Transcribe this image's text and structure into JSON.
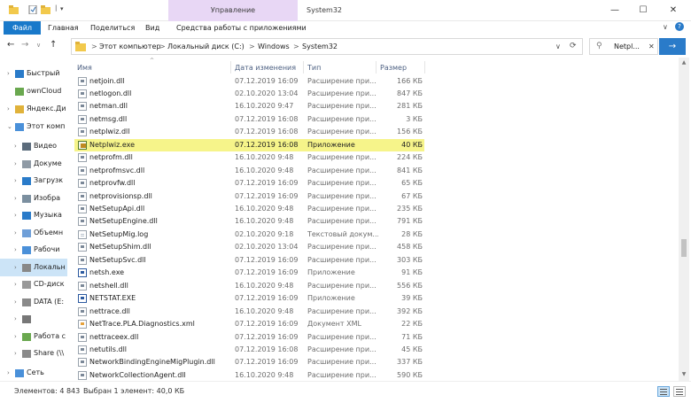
{
  "titlebar": {
    "context_group": "Управление",
    "title": "System32",
    "minimize": "—",
    "maximize": "☐",
    "close": "✕"
  },
  "ribbon": {
    "tabs": [
      "Файл",
      "Главная",
      "Поделиться",
      "Вид",
      "Средства работы с приложениями"
    ]
  },
  "address": {
    "crumbs": [
      "Этот компьютер",
      "Локальный диск (C:)",
      "Windows",
      "System32"
    ],
    "separator": ">",
    "dropdown": "∨",
    "refresh": "⟳"
  },
  "search": {
    "value": "Netpl...",
    "clear": "✕",
    "go": "→"
  },
  "nav": {
    "back": "←",
    "forward": "→",
    "down": "∨",
    "up": "↑",
    "items": [
      {
        "label": "Быстрый",
        "chevron": "›"
      },
      {
        "label": "ownCloud",
        "chevron": ""
      },
      {
        "label": "Яндекс.Ди",
        "chevron": "›"
      },
      {
        "label": "Этот комп",
        "chevron": "⌄"
      },
      {
        "label": "Видео",
        "chevron": "›"
      },
      {
        "label": "Докуме",
        "chevron": "›"
      },
      {
        "label": "Загрузк",
        "chevron": "›"
      },
      {
        "label": "Изобра",
        "chevron": "›"
      },
      {
        "label": "Музыка",
        "chevron": "›"
      },
      {
        "label": "Объемн",
        "chevron": "›"
      },
      {
        "label": "Рабочи",
        "chevron": "›"
      },
      {
        "label": "Локальн",
        "chevron": "›"
      },
      {
        "label": "CD-диск",
        "chevron": "›"
      },
      {
        "label": "DATA (E:",
        "chevron": "›"
      },
      {
        "label": "",
        "chevron": "›"
      },
      {
        "label": "Работа с",
        "chevron": "›"
      },
      {
        "label": "Share (\\\\",
        "chevron": "›"
      },
      {
        "label": "Сеть",
        "chevron": "›"
      }
    ]
  },
  "columns": {
    "name": "Имя",
    "date": "Дата изменения",
    "type": "Тип",
    "size": "Размер",
    "sort_indicator": "^"
  },
  "files": [
    {
      "name": "netjoin.dll",
      "date": "07.12.2019 16:09",
      "type": "Расширение при...",
      "size": "166 КБ",
      "kind": "dll"
    },
    {
      "name": "netlogon.dll",
      "date": "02.10.2020 13:04",
      "type": "Расширение при...",
      "size": "847 КБ",
      "kind": "dll"
    },
    {
      "name": "netman.dll",
      "date": "16.10.2020 9:47",
      "type": "Расширение при...",
      "size": "281 КБ",
      "kind": "dll"
    },
    {
      "name": "netmsg.dll",
      "date": "07.12.2019 16:08",
      "type": "Расширение при...",
      "size": "3 КБ",
      "kind": "dll"
    },
    {
      "name": "netplwiz.dll",
      "date": "07.12.2019 16:08",
      "type": "Расширение при...",
      "size": "156 КБ",
      "kind": "dll"
    },
    {
      "name": "Netplwiz.exe",
      "date": "07.12.2019 16:08",
      "type": "Приложение",
      "size": "40 КБ",
      "kind": "exe",
      "selected": true
    },
    {
      "name": "netprofm.dll",
      "date": "16.10.2020 9:48",
      "type": "Расширение при...",
      "size": "224 КБ",
      "kind": "dll"
    },
    {
      "name": "netprofmsvc.dll",
      "date": "16.10.2020 9:48",
      "type": "Расширение при...",
      "size": "841 КБ",
      "kind": "dll"
    },
    {
      "name": "netprovfw.dll",
      "date": "07.12.2019 16:09",
      "type": "Расширение при...",
      "size": "65 КБ",
      "kind": "dll"
    },
    {
      "name": "netprovisionsp.dll",
      "date": "07.12.2019 16:09",
      "type": "Расширение при...",
      "size": "67 КБ",
      "kind": "dll"
    },
    {
      "name": "NetSetupApi.dll",
      "date": "16.10.2020 9:48",
      "type": "Расширение при...",
      "size": "235 КБ",
      "kind": "dll"
    },
    {
      "name": "NetSetupEngine.dll",
      "date": "16.10.2020 9:48",
      "type": "Расширение при...",
      "size": "791 КБ",
      "kind": "dll"
    },
    {
      "name": "NetSetupMig.log",
      "date": "02.10.2020 9:18",
      "type": "Текстовый докум...",
      "size": "28 КБ",
      "kind": "txt"
    },
    {
      "name": "NetSetupShim.dll",
      "date": "02.10.2020 13:04",
      "type": "Расширение при...",
      "size": "458 КБ",
      "kind": "dll"
    },
    {
      "name": "NetSetupSvc.dll",
      "date": "07.12.2019 16:09",
      "type": "Расширение при...",
      "size": "303 КБ",
      "kind": "dll"
    },
    {
      "name": "netsh.exe",
      "date": "07.12.2019 16:09",
      "type": "Приложение",
      "size": "91 КБ",
      "kind": "sys"
    },
    {
      "name": "netshell.dll",
      "date": "16.10.2020 9:48",
      "type": "Расширение при...",
      "size": "556 КБ",
      "kind": "dll"
    },
    {
      "name": "NETSTAT.EXE",
      "date": "07.12.2019 16:09",
      "type": "Приложение",
      "size": "39 КБ",
      "kind": "sys"
    },
    {
      "name": "nettrace.dll",
      "date": "16.10.2020 9:48",
      "type": "Расширение при...",
      "size": "392 КБ",
      "kind": "dll"
    },
    {
      "name": "NetTrace.PLA.Diagnostics.xml",
      "date": "07.12.2019 16:09",
      "type": "Документ XML",
      "size": "22 КБ",
      "kind": "xml"
    },
    {
      "name": "nettraceex.dll",
      "date": "07.12.2019 16:09",
      "type": "Расширение при...",
      "size": "71 КБ",
      "kind": "dll"
    },
    {
      "name": "netutils.dll",
      "date": "07.12.2019 16:08",
      "type": "Расширение при...",
      "size": "45 КБ",
      "kind": "dll"
    },
    {
      "name": "NetworkBindingEngineMigPlugin.dll",
      "date": "07.12.2019 16:09",
      "type": "Расширение при...",
      "size": "337 КБ",
      "kind": "dll"
    },
    {
      "name": "NetworkCollectionAgent.dll",
      "date": "16.10.2020 9:48",
      "type": "Расширение при...",
      "size": "590 КБ",
      "kind": "dll"
    }
  ],
  "status": {
    "count": "Элементов: 4 843",
    "selection": "Выбран 1 элемент: 40,0 КБ"
  },
  "colors": {
    "accent": "#1979ca",
    "selected_row": "#f6f48a",
    "context_tab": "#e8d7f5",
    "folder": "#f2c94c"
  }
}
